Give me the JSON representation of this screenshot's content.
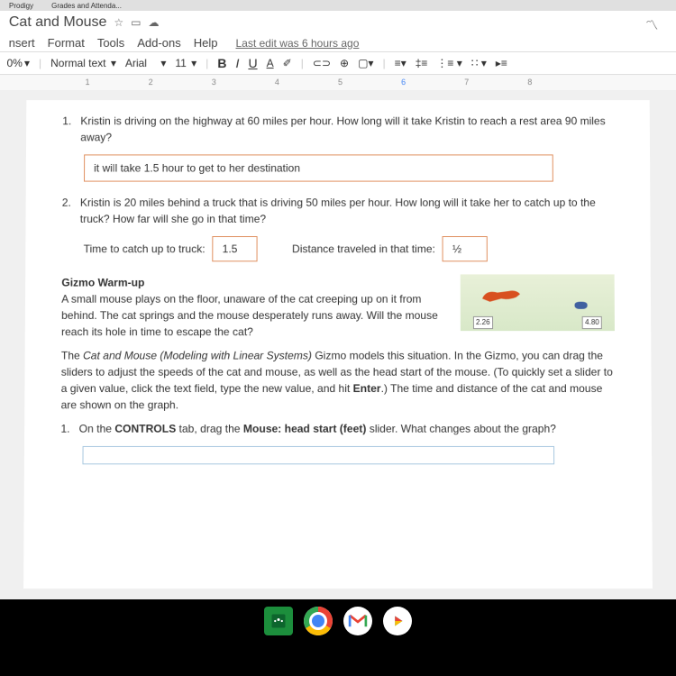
{
  "tabs": {
    "t1": "Prodigy",
    "t2": "Grades and Attenda..."
  },
  "doc": {
    "title": "Cat and Mouse",
    "menu": {
      "insert": "nsert",
      "format": "Format",
      "tools": "Tools",
      "addons": "Add-ons",
      "help": "Help"
    },
    "last_edit": "Last edit was 6 hours ago",
    "toolbar": {
      "zoom": "0%",
      "style": "Normal text",
      "font": "Arial",
      "size": "11"
    },
    "ruler": {
      "r1": "1",
      "r2": "2",
      "r3": "3",
      "r4": "4",
      "r5": "5",
      "r6": "6",
      "r7": "7",
      "r8": "8"
    }
  },
  "content": {
    "q1_num": "1.",
    "q1": "Kristin is driving on the highway at 60 miles per hour. How long will it take Kristin to reach a rest area 90 miles away?",
    "a1": "it will take 1.5 hour to get to her destination",
    "q2_num": "2.",
    "q2": "Kristin is 20 miles behind a truck that is driving 50 miles per hour. How long will it take her to catch up to the truck? How far will she go in that time?",
    "q2a_label": "Time to catch up to truck:",
    "q2a_val": "1.5",
    "q2b_label": "Distance traveled in that time:",
    "q2b_val": "½",
    "warmup_title": "Gizmo Warm-up",
    "warmup_text": "A small mouse plays on the floor, unaware of the cat creeping up on it from behind. The cat springs and the mouse desperately runs away. Will the mouse reach its hole in time to escape the cat?",
    "img_label1": "2.26",
    "img_label2": "4.80",
    "para2a": "The ",
    "para2b": "Cat and Mouse (Modeling with Linear Systems)",
    "para2c": " Gizmo models this situation. In the Gizmo, you can drag the sliders to adjust the speeds of the cat and mouse, as well as the head start of the mouse. (To quickly set a slider to a given value, click the text field, type the new value, and hit ",
    "para2d": "Enter",
    "para2e": ".) The time and distance of the cat and mouse are shown on the graph.",
    "q3_num": "1.",
    "q3a": "On the ",
    "q3b": "CONTROLS",
    "q3c": " tab, drag the ",
    "q3d": "Mouse: head start (feet)",
    "q3e": " slider. What changes about the graph?"
  }
}
